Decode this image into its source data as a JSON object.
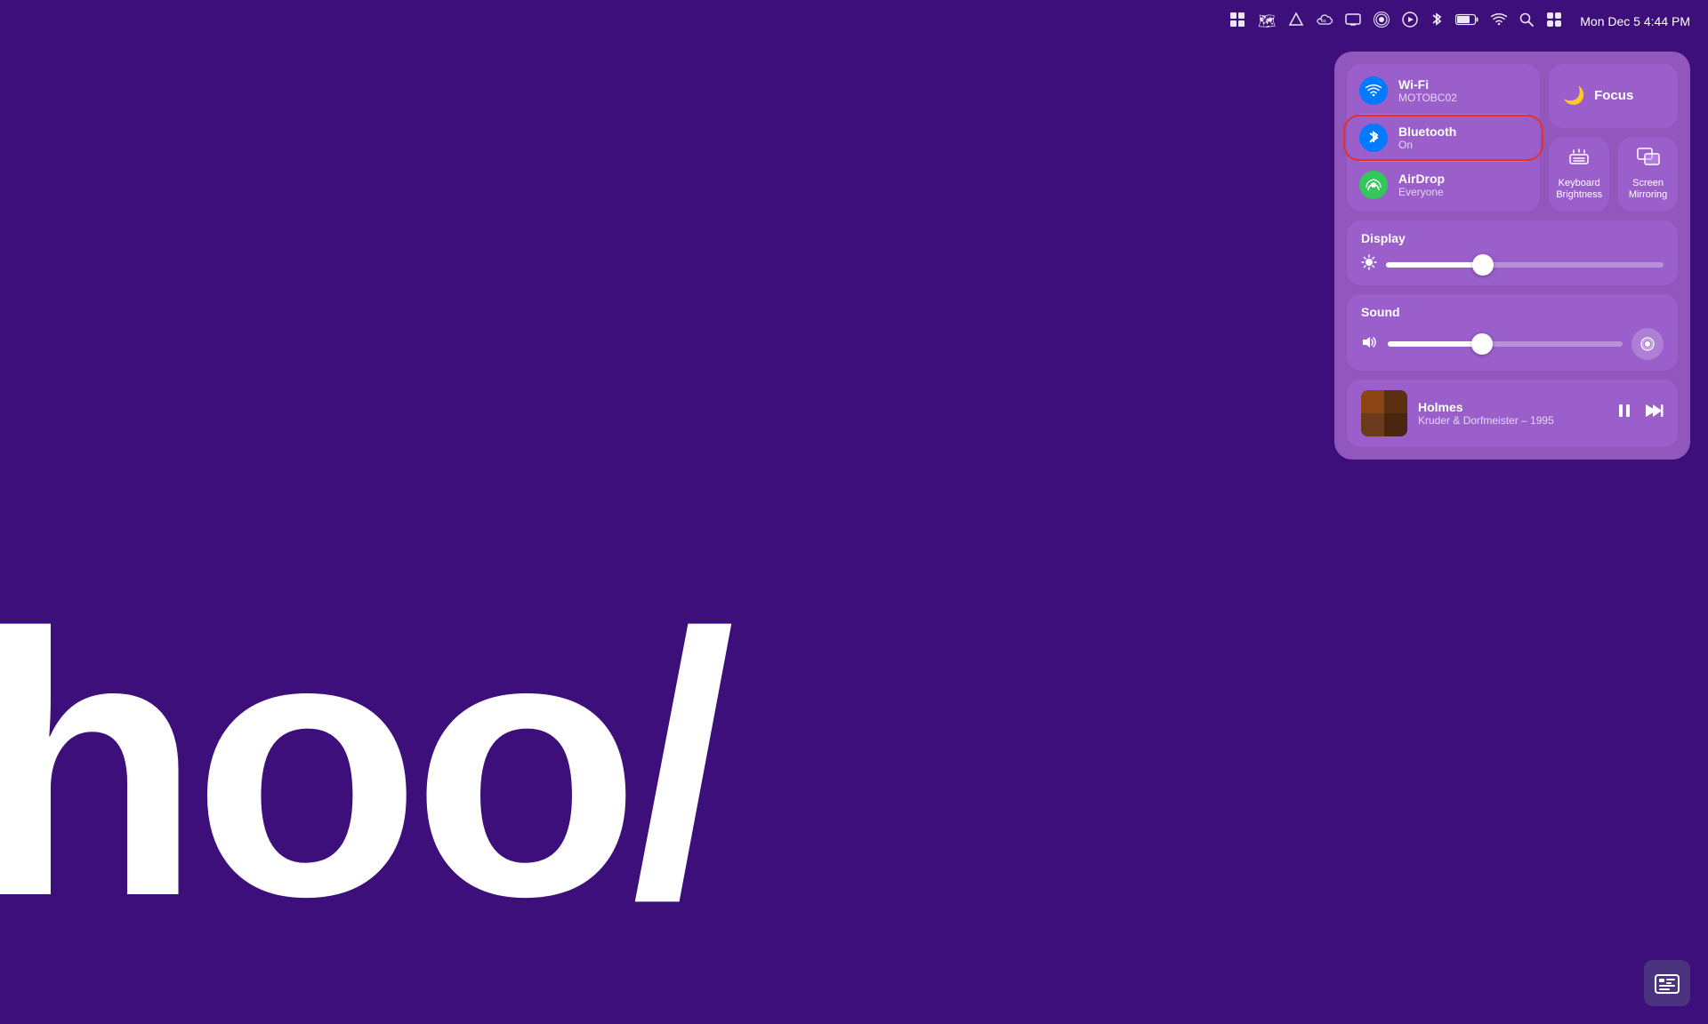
{
  "menubar": {
    "time": "Mon Dec 5  4:44 PM",
    "icons": [
      {
        "name": "file-browser-icon",
        "symbol": "▦"
      },
      {
        "name": "maps-icon",
        "symbol": "🗺"
      },
      {
        "name": "delta-icon",
        "symbol": "▲"
      },
      {
        "name": "creative-cloud-icon",
        "symbol": "∞"
      },
      {
        "name": "screen-icon",
        "symbol": "▭"
      },
      {
        "name": "podcast-icon",
        "symbol": "⏺"
      },
      {
        "name": "play-icon",
        "symbol": "▶"
      },
      {
        "name": "bluetooth-menu-icon",
        "symbol": "✱"
      },
      {
        "name": "battery-icon",
        "symbol": "🔋"
      },
      {
        "name": "wifi-menu-icon",
        "symbol": "wifi"
      },
      {
        "name": "search-icon",
        "symbol": "🔍"
      },
      {
        "name": "control-center-icon",
        "symbol": "⊞"
      }
    ]
  },
  "desktop": {
    "text": "hoo/"
  },
  "control_center": {
    "connectivity": {
      "wifi": {
        "name": "Wi-Fi",
        "status": "MOTOBC02"
      },
      "bluetooth": {
        "name": "Bluetooth",
        "status": "On",
        "highlighted": true
      },
      "airdrop": {
        "name": "AirDrop",
        "status": "Everyone"
      }
    },
    "focus": {
      "label": "Focus"
    },
    "keyboard_brightness": {
      "label": "Keyboard\nBrightness"
    },
    "screen_mirroring": {
      "label": "Screen\nMirroring"
    },
    "display": {
      "title": "Display",
      "brightness_percent": 35
    },
    "sound": {
      "title": "Sound",
      "volume_percent": 40
    },
    "music": {
      "title": "Holmes",
      "subtitle": "Kruder & Dorfmeister – 1995"
    }
  }
}
